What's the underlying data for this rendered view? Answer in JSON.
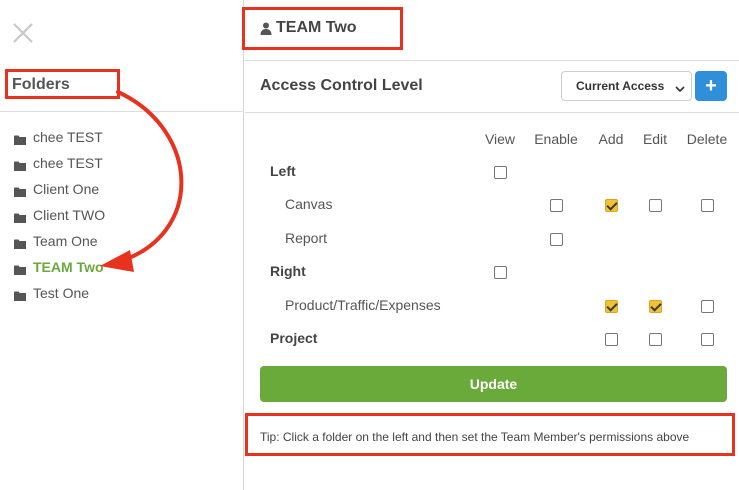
{
  "sidebar": {
    "title": "Folders",
    "folders": [
      {
        "label": "chee TEST",
        "active": false
      },
      {
        "label": "chee TEST",
        "active": false
      },
      {
        "label": "Client One",
        "active": false
      },
      {
        "label": "Client TWO",
        "active": false
      },
      {
        "label": "Team One",
        "active": false
      },
      {
        "label": "TEAM Two",
        "active": true
      },
      {
        "label": "Test One",
        "active": false
      }
    ]
  },
  "header": {
    "team_name": "TEAM Two",
    "section_title": "Access Control Level",
    "access_select_value": "Current Access",
    "add_button_label": "+"
  },
  "permissions": {
    "columns": [
      "View",
      "Enable",
      "Add",
      "Edit",
      "Delete"
    ],
    "rows": [
      {
        "label": "Left",
        "type": "section",
        "cells": {
          "View": false
        }
      },
      {
        "label": "Canvas",
        "type": "sub",
        "cells": {
          "Enable": false,
          "Add": true,
          "Edit": false,
          "Delete": false
        }
      },
      {
        "label": "Report",
        "type": "sub",
        "cells": {
          "Enable": false
        }
      },
      {
        "label": "Right",
        "type": "section",
        "cells": {
          "View": false
        }
      },
      {
        "label": "Product/Traffic/Expenses",
        "type": "sub",
        "cells": {
          "Add": true,
          "Edit": true,
          "Delete": false
        }
      },
      {
        "label": "Project",
        "type": "section",
        "cells": {
          "Add": false,
          "Edit": false,
          "Delete": false
        }
      }
    ]
  },
  "update_button_label": "Update",
  "tip_text": "Tip: Click a folder on the left and then set the Team Member's permissions above",
  "colors": {
    "accent_green": "#6aaa3a",
    "button_blue": "#2f8fd8",
    "checkbox_checked": "#f2c232",
    "annotation_red": "#e8321e"
  }
}
